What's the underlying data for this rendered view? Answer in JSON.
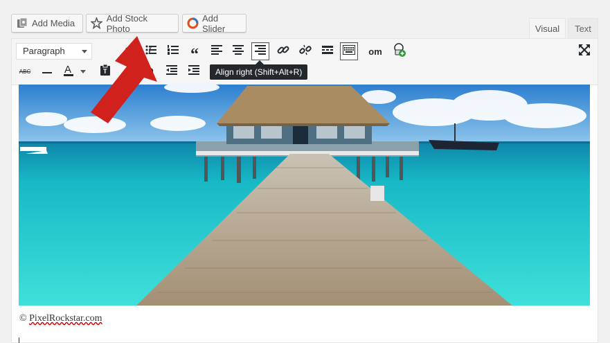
{
  "media_buttons": {
    "add_media": "Add Media",
    "add_stock_photo": "Add Stock Photo",
    "add_slider": "Add Slider"
  },
  "tabs": {
    "visual": "Visual",
    "text": "Text"
  },
  "toolbar": {
    "format_select": "Paragraph",
    "partial_label": "om"
  },
  "tooltip": "Align right (Shift+Alt+R)",
  "caption": {
    "copyright": "©",
    "site": "PixelRockstar.com"
  },
  "colors": {
    "accent_red": "#d0211c",
    "sky": "#3d8fd6",
    "water": "#27c7cf",
    "text_color_bar": "#23282d"
  },
  "icons": [
    "media-icon",
    "stock-photo-icon",
    "slider-icon",
    "bold-icon",
    "italic-icon",
    "bullet-list-icon",
    "numbered-list-icon",
    "blockquote-icon",
    "align-left-icon",
    "align-center-icon",
    "align-right-icon",
    "link-icon",
    "unlink-icon",
    "read-more-icon",
    "toolbar-toggle-icon",
    "plugin-icon",
    "fullscreen-icon",
    "strikethrough-icon",
    "horizontal-line-icon",
    "text-color-icon",
    "paste-text-icon",
    "clear-formatting-icon",
    "special-character-icon",
    "outdent-icon",
    "indent-icon"
  ]
}
